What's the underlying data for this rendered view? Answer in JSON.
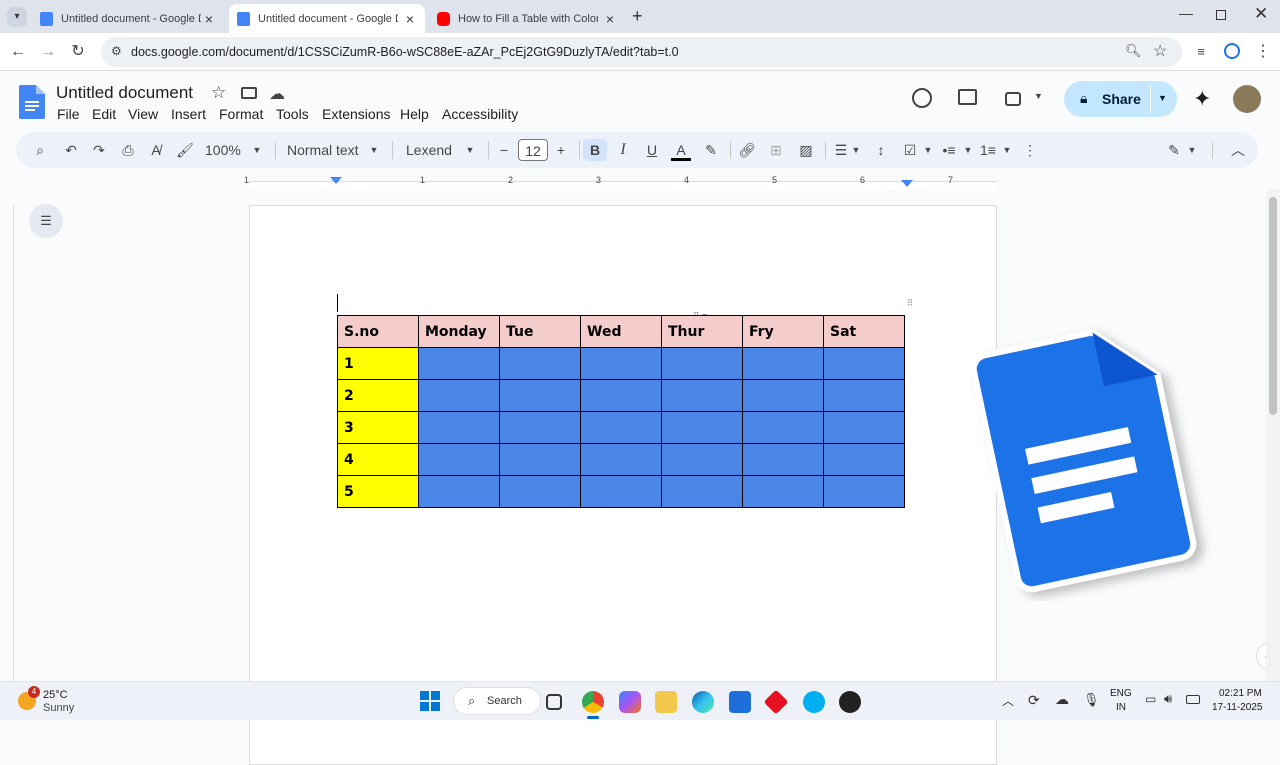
{
  "browser": {
    "tabs": [
      {
        "title": "Untitled document - Google Do",
        "color": "#4285f4"
      },
      {
        "title": "Untitled document - Google Do",
        "color": "#4285f4"
      },
      {
        "title": "How to Fill a Table with Color in",
        "color": "#ff0000"
      }
    ],
    "url": "docs.google.com/document/d/1CSSCiZumR-B6o-wSC88eE-aZAr_PcEj2GtG9DuzlyTA/edit?tab=t.0"
  },
  "docs": {
    "title": "Untitled document",
    "menu": [
      "File",
      "Edit",
      "View",
      "Insert",
      "Format",
      "Tools",
      "Extensions",
      "Help",
      "Accessibility"
    ],
    "share_label": "Share",
    "toolbar": {
      "zoom": "100%",
      "style": "Normal text",
      "font": "Lexend",
      "font_size": "12"
    },
    "ruler_numbers": [
      "1",
      "1",
      "2",
      "3",
      "4",
      "5",
      "6",
      "7"
    ]
  },
  "table": {
    "headers": [
      "S.no",
      "Monday",
      "Tue",
      "Wed",
      "Thur",
      "Fry",
      "Sat"
    ],
    "rows": [
      "1",
      "2",
      "3",
      "4",
      "5"
    ],
    "colors": {
      "header": "#f4cccc",
      "sno": "#ffff00",
      "cells": "#4a86e8"
    }
  },
  "taskbar": {
    "weather_temp": "25°C",
    "weather_desc": "Sunny",
    "weather_badge": "4",
    "search_label": "Search",
    "lang_line1": "ENG",
    "lang_line2": "IN",
    "time": "02:21 PM",
    "date": "17-11-2025"
  }
}
